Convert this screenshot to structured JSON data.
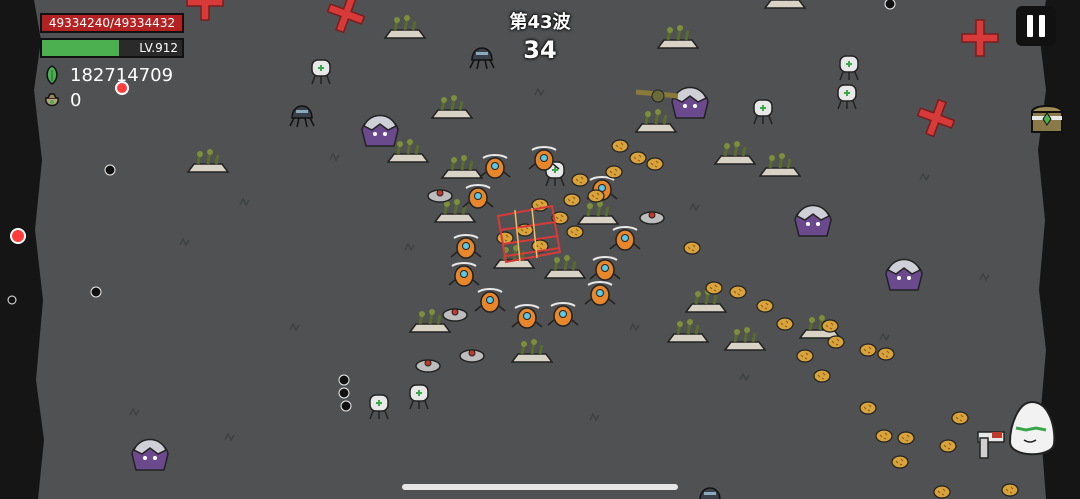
{
  "player": {
    "hp_text": "49334240/49334432",
    "level_text": "LV.912",
    "xp_progress": 0.55
  },
  "resources": {
    "gems": "182714709",
    "bags": "0"
  },
  "wave": {
    "title": "第43波",
    "timer": "34"
  },
  "icons": {
    "gem": "green-gem-icon",
    "bag": "loot-bag-icon",
    "pause": "pause-icon",
    "chest": "treasure-chest-icon"
  },
  "colors": {
    "background": "#4f5152",
    "hp_bar": "#b22222",
    "xp_fill": "#4caf50",
    "text": "#ffffff",
    "enemy_orange": "#e8862b",
    "enemy_purple": "#6a4a8c",
    "coin": "#d9a23a",
    "red_cross": "#d83a3a"
  }
}
